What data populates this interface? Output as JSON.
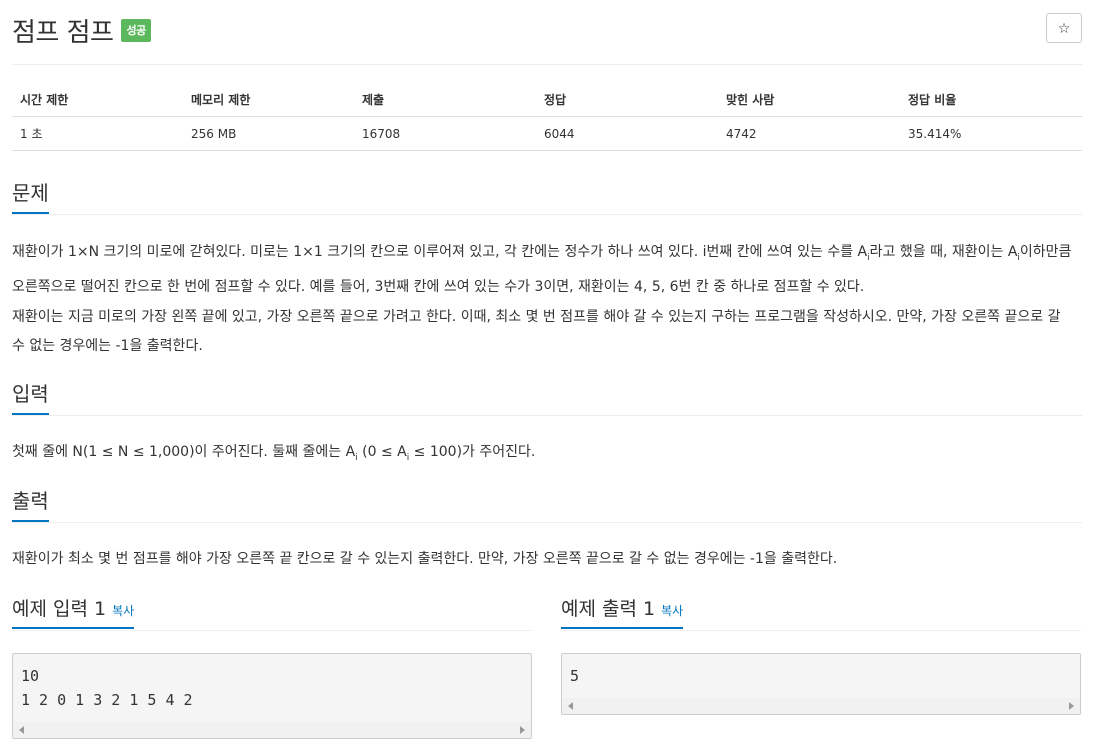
{
  "problem": {
    "title": "점프 점프",
    "status_badge": "성공",
    "star_icon": "☆"
  },
  "info_table": {
    "headers": [
      "시간 제한",
      "메모리 제한",
      "제출",
      "정답",
      "맞힌 사람",
      "정답 비율"
    ],
    "values": [
      "1 초",
      "256 MB",
      "16708",
      "6044",
      "4742",
      "35.414%"
    ]
  },
  "sections": {
    "problem": {
      "heading": "문제",
      "p1_a": "재환이가 1×N 크기의 미로에 갇혀있다. 미로는 1×1 크기의 칸으로 이루어져 있고, 각 칸에는 정수가 하나 쓰여 있다. i번째 칸에 쓰여 있는 수를 A",
      "p1_sub1": "i",
      "p1_b": "라고 했을 때, 재환이는 A",
      "p1_sub2": "i",
      "p1_c": "이하만큼 오른쪽으로 떨어진 칸으로 한 번에 점프할 수 있다. 예를 들어, 3번째 칸에 쓰여 있는 수가 3이면, 재환이는 4, 5, 6번 칸 중 하나로 점프할 수 있다.",
      "p2": "재환이는 지금 미로의 가장 왼쪽 끝에 있고, 가장 오른쪽 끝으로 가려고 한다. 이때, 최소 몇 번 점프를 해야 갈 수 있는지 구하는 프로그램을 작성하시오. 만약, 가장 오른쪽 끝으로 갈 수 없는 경우에는 -1을 출력한다."
    },
    "input": {
      "heading": "입력",
      "p_a": "첫째 줄에 N(1 ≤ N ≤ 1,000)이 주어진다. 둘째 줄에는 A",
      "p_sub1": "i",
      "p_b": " (0 ≤ A",
      "p_sub2": "i",
      "p_c": " ≤ 100)가 주어진다."
    },
    "output": {
      "heading": "출력",
      "p": "재환이가 최소 몇 번 점프를 해야 가장 오른쪽 끝 칸으로 갈 수 있는지 출력한다. 만약, 가장 오른쪽 끝으로 갈 수 없는 경우에는 -1을 출력한다."
    }
  },
  "samples": {
    "input_heading": "예제 입력 1",
    "output_heading": "예제 출력 1",
    "copy_label": "복사",
    "input_text": "10\n1 2 0 1 3 2 1 5 4 2",
    "output_text": "5"
  },
  "colors": {
    "accent": "#0076c0",
    "badge": "#5cb85c"
  }
}
